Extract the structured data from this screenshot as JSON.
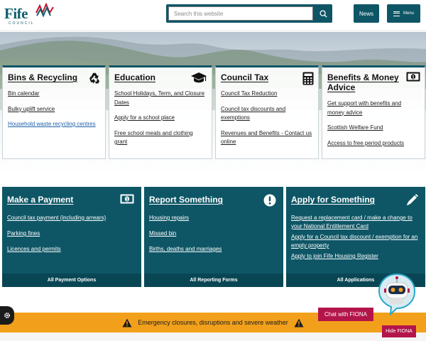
{
  "header": {
    "logo_text": "Fife",
    "logo_subtext": "COUNCIL",
    "search_placeholder": "Search this website",
    "search_icon": "search-icon",
    "news_label": "News",
    "menu_label": "Menu",
    "menu_icon": "hamburger-icon"
  },
  "top_cards": [
    {
      "title": "Bins & Recycling",
      "icon": "recycle-icon",
      "links": [
        "Bin calendar",
        "Bulky uplift service",
        "Household waste recycling centres"
      ]
    },
    {
      "title": "Education",
      "icon": "graduation-cap-icon",
      "links": [
        "School Holidays, Term, and Closure Dates",
        "Apply for a school place",
        "Free school meals and clothing grant"
      ]
    },
    {
      "title": "Council Tax",
      "icon": "calculator-icon",
      "links": [
        "Council Tax Reduction",
        "Council tax discounts and exemptions",
        "Revenues and Benefits - Contact us online"
      ]
    },
    {
      "title": "Benefits & Money Advice",
      "icon": "banknote-icon",
      "links": [
        "Get support with benefits and money advice",
        "Scottish Welfare Fund",
        "Access to free period products"
      ]
    }
  ],
  "panels": [
    {
      "title": "Make a Payment",
      "icon": "banknote-icon",
      "links": [
        "Council tax payment (including arrears)",
        "Parking fines",
        "Licences and permits"
      ],
      "footer": "All Payment Options"
    },
    {
      "title": "Report Something",
      "icon": "exclamation-icon",
      "links": [
        "Housing repairs",
        "Missed bin",
        "Births, deaths and marriages"
      ],
      "footer": "All Reporting Forms"
    },
    {
      "title": "Apply for Something",
      "icon": "pencil-icon",
      "links": [
        "Request a replacement card / make a change to your National Entitlement Card",
        "Apply for a Council tax discount / exemption for an empty property",
        "Apply to join Fife Housing Register"
      ],
      "footer": "All Applications"
    }
  ],
  "alert": {
    "text": "Emergency closures, disruptions and severe weather",
    "icon": "warning-icon"
  },
  "chat": {
    "chat_label": "Chat with FIONA",
    "hide_label": "Hide FIONA",
    "avatar_icon": "robot-avatar-icon"
  },
  "cookie": {
    "icon": "gear-icon"
  },
  "colors": {
    "brand_teal": "#0e5666",
    "alert_orange": "#f2a01b",
    "chat_magenta": "#b3154a"
  }
}
